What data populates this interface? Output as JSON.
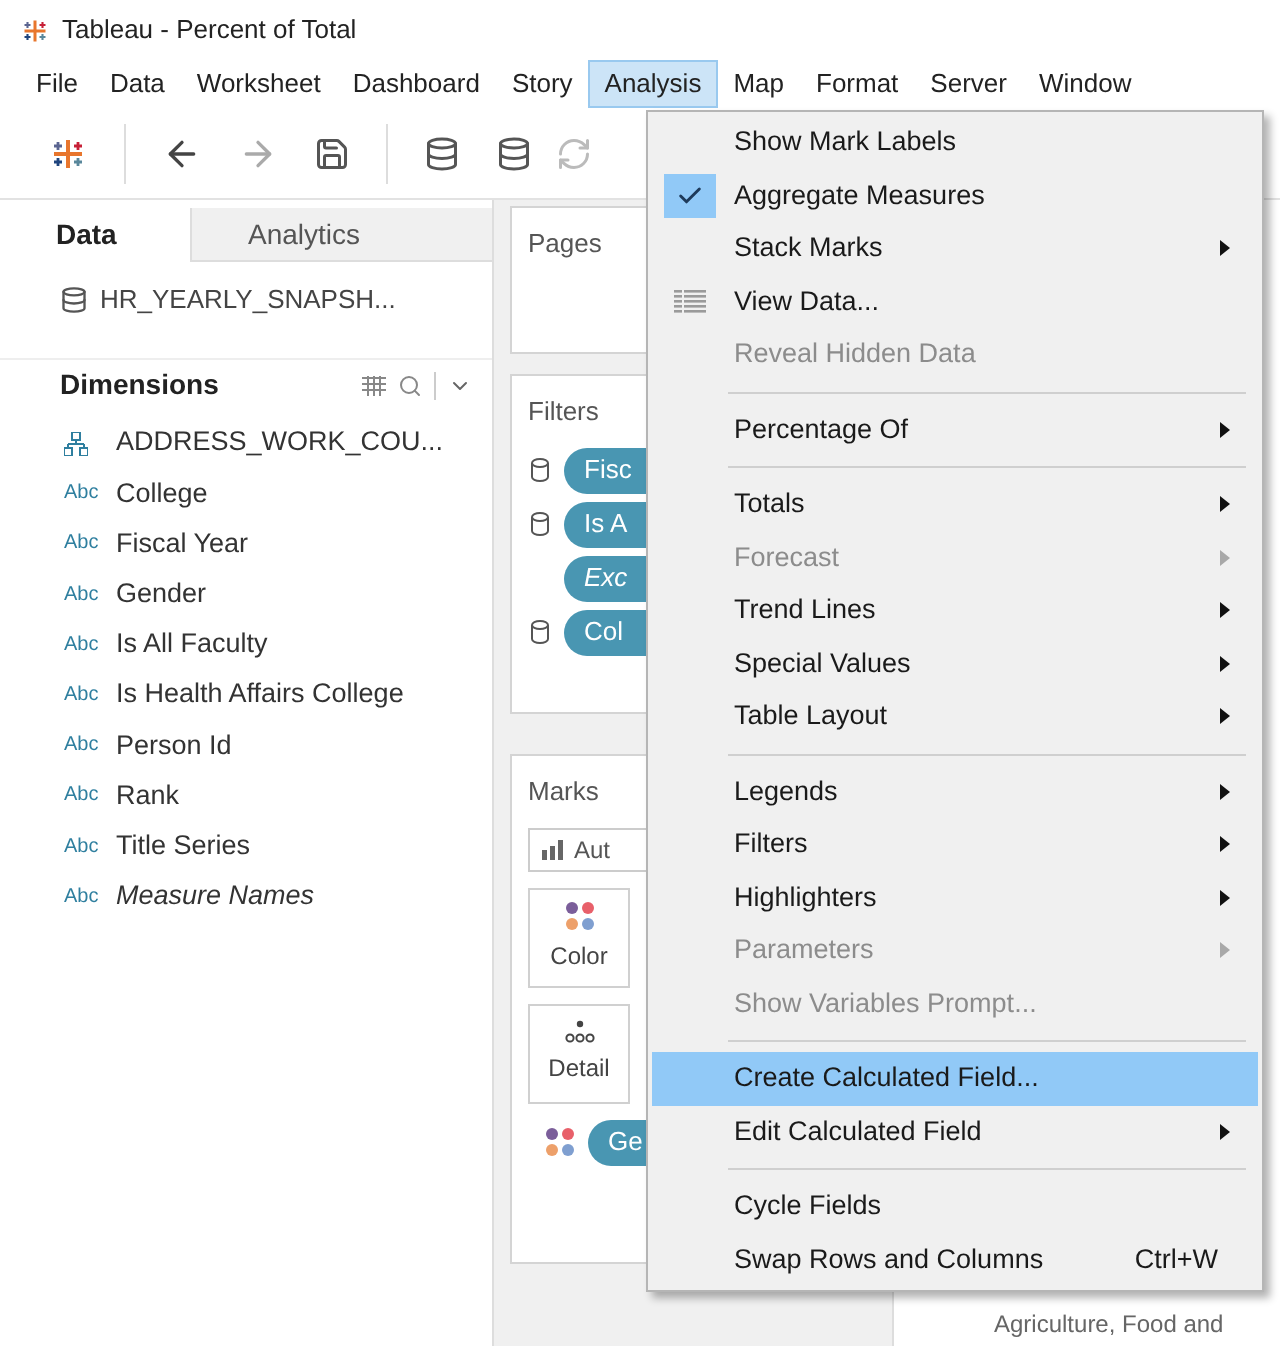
{
  "window": {
    "title": "Tableau - Percent of Total"
  },
  "menubar": [
    {
      "label": "File",
      "selected": false
    },
    {
      "label": "Data",
      "selected": false
    },
    {
      "label": "Worksheet",
      "selected": false
    },
    {
      "label": "Dashboard",
      "selected": false
    },
    {
      "label": "Story",
      "selected": false
    },
    {
      "label": "Analysis",
      "selected": true
    },
    {
      "label": "Map",
      "selected": false
    },
    {
      "label": "Format",
      "selected": false
    },
    {
      "label": "Server",
      "selected": false
    },
    {
      "label": "Window",
      "selected": false
    }
  ],
  "side_tabs": [
    {
      "label": "Data",
      "selected": true
    },
    {
      "label": "Analytics",
      "selected": false
    }
  ],
  "datasource": "HR_YEARLY_SNAPSH...",
  "dimensions": {
    "title": "Dimensions",
    "fields": [
      {
        "kind": "hierarchy",
        "label": "ADDRESS_WORK_COU...",
        "italic": false
      },
      {
        "kind": "string",
        "type_label": "Abc",
        "label": "College",
        "italic": false
      },
      {
        "kind": "string",
        "type_label": "Abc",
        "label": "Fiscal Year",
        "italic": false
      },
      {
        "kind": "string",
        "type_label": "Abc",
        "label": "Gender",
        "italic": false
      },
      {
        "kind": "string",
        "type_label": "Abc",
        "label": "Is All Faculty",
        "italic": false
      },
      {
        "kind": "string",
        "type_label": "Abc",
        "label": "Is Health Affairs College",
        "italic": false
      },
      {
        "kind": "string",
        "type_label": "Abc",
        "label": "Person Id",
        "italic": false
      },
      {
        "kind": "string",
        "type_label": "Abc",
        "label": "Rank",
        "italic": false
      },
      {
        "kind": "string",
        "type_label": "Abc",
        "label": "Title Series",
        "italic": false
      },
      {
        "kind": "string",
        "type_label": "Abc",
        "label": "Measure Names",
        "italic": true
      }
    ]
  },
  "pages": {
    "title": "Pages"
  },
  "filters": {
    "title": "Filters",
    "pills": [
      {
        "label": "Fisc",
        "italic": false,
        "source": true
      },
      {
        "label": "Is A",
        "italic": false,
        "source": true
      },
      {
        "label": "Exc",
        "italic": true,
        "source": false
      },
      {
        "label": "Col",
        "italic": false,
        "source": true
      }
    ]
  },
  "marks": {
    "title": "Marks",
    "mark_type": "Aut",
    "cards": [
      {
        "kind": "color",
        "label": "Color"
      },
      {
        "kind": "detail",
        "label": "Detail"
      }
    ],
    "pill": "Ge"
  },
  "canvas": {
    "axis_label": "Agriculture, Food and"
  },
  "menu": {
    "items": [
      {
        "kind": "item",
        "label": "Show Mark Labels",
        "checked": false,
        "disabled": false,
        "submenu": false,
        "selected": false
      },
      {
        "kind": "item",
        "label": "Aggregate Measures",
        "checked": true,
        "disabled": false,
        "submenu": false,
        "selected": false
      },
      {
        "kind": "item",
        "label": "Stack Marks",
        "checked": false,
        "disabled": false,
        "submenu": true,
        "selected": false
      },
      {
        "kind": "view_data",
        "label": "View Data...",
        "disabled": false,
        "submenu": false,
        "selected": false
      },
      {
        "kind": "item",
        "label": "Reveal Hidden Data",
        "checked": false,
        "disabled": true,
        "submenu": false,
        "selected": false
      },
      {
        "kind": "separator"
      },
      {
        "kind": "item",
        "label": "Percentage Of",
        "checked": false,
        "disabled": false,
        "submenu": true,
        "selected": false
      },
      {
        "kind": "separator"
      },
      {
        "kind": "item",
        "label": "Totals",
        "checked": false,
        "disabled": false,
        "submenu": true,
        "selected": false
      },
      {
        "kind": "item",
        "label": "Forecast",
        "checked": false,
        "disabled": true,
        "submenu": true,
        "selected": false
      },
      {
        "kind": "item",
        "label": "Trend Lines",
        "checked": false,
        "disabled": false,
        "submenu": true,
        "selected": false
      },
      {
        "kind": "item",
        "label": "Special Values",
        "checked": false,
        "disabled": false,
        "submenu": true,
        "selected": false
      },
      {
        "kind": "item",
        "label": "Table Layout",
        "checked": false,
        "disabled": false,
        "submenu": true,
        "selected": false
      },
      {
        "kind": "separator"
      },
      {
        "kind": "item",
        "label": "Legends",
        "checked": false,
        "disabled": false,
        "submenu": true,
        "selected": false
      },
      {
        "kind": "item",
        "label": "Filters",
        "checked": false,
        "disabled": false,
        "submenu": true,
        "selected": false
      },
      {
        "kind": "item",
        "label": "Highlighters",
        "checked": false,
        "disabled": false,
        "submenu": true,
        "selected": false
      },
      {
        "kind": "item",
        "label": "Parameters",
        "checked": false,
        "disabled": true,
        "submenu": true,
        "selected": false
      },
      {
        "kind": "item",
        "label": "Show Variables Prompt...",
        "checked": false,
        "disabled": true,
        "submenu": false,
        "selected": false
      },
      {
        "kind": "separator"
      },
      {
        "kind": "item",
        "label": "Create Calculated Field...",
        "checked": false,
        "disabled": false,
        "submenu": false,
        "selected": true
      },
      {
        "kind": "item",
        "label": "Edit Calculated Field",
        "checked": false,
        "disabled": false,
        "submenu": true,
        "selected": false
      },
      {
        "kind": "separator"
      },
      {
        "kind": "item",
        "label": "Cycle Fields",
        "checked": false,
        "disabled": false,
        "submenu": false,
        "selected": false
      },
      {
        "kind": "item",
        "label": "Swap Rows and Columns",
        "checked": false,
        "disabled": false,
        "submenu": false,
        "selected": false,
        "shortcut": "Ctrl+W"
      }
    ]
  }
}
